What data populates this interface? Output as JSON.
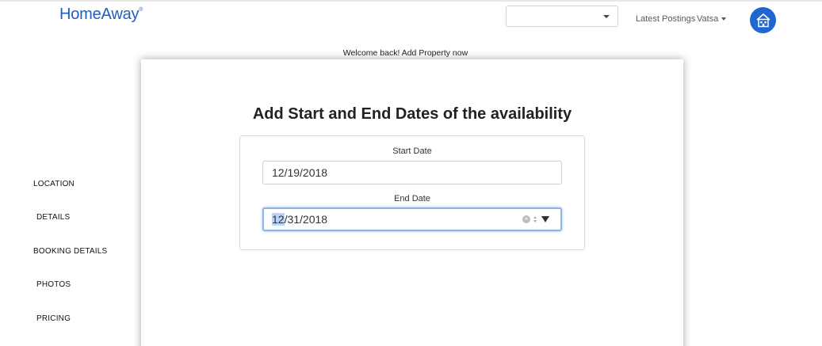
{
  "header": {
    "logo_text": "HomeAway",
    "logo_mark": "®",
    "select_value": "",
    "nav_links": [
      "Latest Postings",
      "Vatsa"
    ],
    "home_icon": "house-icon",
    "accent_color": "#1f66d1"
  },
  "welcome_text": "Welcome back! Add Property now",
  "sidebar": {
    "items": [
      "LOCATION",
      "DETAILS",
      "BOOKING DETAILS",
      "PHOTOS",
      "PRICING"
    ]
  },
  "main": {
    "title": "Add Start and End Dates of the availability",
    "start": {
      "label": "Start Date",
      "value": "12/19/2018"
    },
    "end": {
      "label": "End Date",
      "month_selected": "12",
      "value_rest": "/31/2018"
    }
  }
}
